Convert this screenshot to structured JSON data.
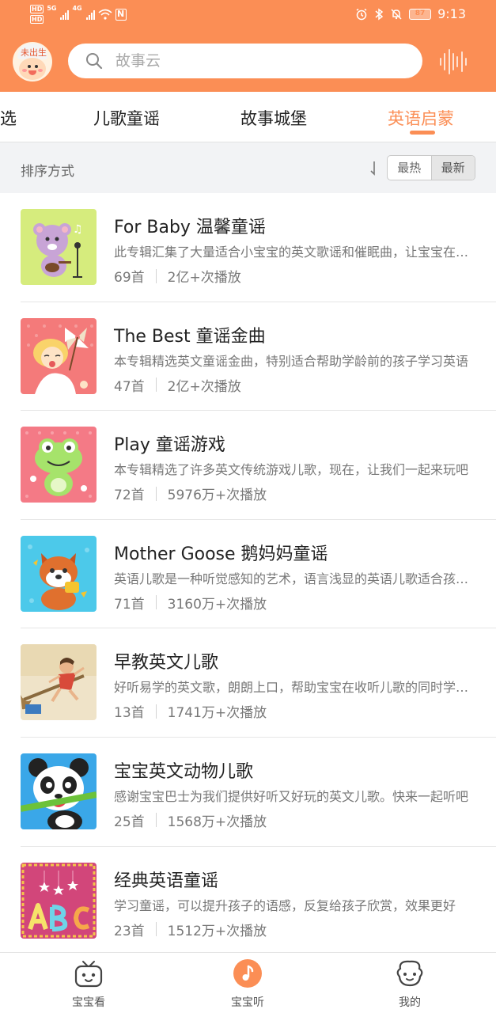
{
  "status_bar": {
    "left_tags": [
      "HD",
      "HD"
    ],
    "net_5g": "5G",
    "net_4g": "4G",
    "battery": "87",
    "time": "9:13"
  },
  "header": {
    "avatar_tag": "未出生",
    "search_placeholder": "故事云"
  },
  "tabs": [
    {
      "label": "选"
    },
    {
      "label": "儿歌童谣"
    },
    {
      "label": "故事城堡"
    },
    {
      "label": "英语启蒙",
      "active": true
    }
  ],
  "sort": {
    "label": "排序方式",
    "hot": "最热",
    "new": "最新"
  },
  "albums": [
    {
      "title": "For Baby 温馨童谣",
      "desc": "此专辑汇集了大量适合小宝宝的英文歌谣和催眠曲，让宝宝在轻柔的音乐中入睡",
      "count": "69首",
      "plays": "2亿+次播放"
    },
    {
      "title": "The Best 童谣金曲",
      "desc": "本专辑精选英文童谣金曲，特别适合帮助学龄前的孩子学习英语",
      "count": "47首",
      "plays": "2亿+次播放"
    },
    {
      "title": "Play 童谣游戏",
      "desc": "本专辑精选了许多英文传统游戏儿歌，现在，让我们一起来玩吧",
      "count": "72首",
      "plays": "5976万+次播放"
    },
    {
      "title": "Mother Goose 鹅妈妈童谣",
      "desc": "英语儿歌是一种听觉感知的艺术，语言浅显的英语儿歌适合孩子学习",
      "count": "71首",
      "plays": "3160万+次播放"
    },
    {
      "title": "早教英文儿歌",
      "desc": "好听易学的英文歌，朗朗上口，帮助宝宝在收听儿歌的同时学习英语",
      "count": "13首",
      "plays": "1741万+次播放"
    },
    {
      "title": "宝宝英文动物儿歌",
      "desc": "感谢宝宝巴士为我们提供好听又好玩的英文儿歌。快来一起听吧",
      "count": "25首",
      "plays": "1568万+次播放"
    },
    {
      "title": "经典英语童谣",
      "desc": "学习童谣，可以提升孩子的语感，反复给孩子欣赏，效果更好",
      "count": "23首",
      "plays": "1512万+次播放"
    }
  ],
  "bottom_nav": [
    {
      "label": "宝宝看",
      "icon": "tv-icon"
    },
    {
      "label": "宝宝听",
      "icon": "music-note-icon",
      "active": true
    },
    {
      "label": "我的",
      "icon": "smiley-icon"
    }
  ],
  "colors": {
    "accent": "#fb8e55",
    "sort_bar_bg": "#f2f3f5"
  }
}
